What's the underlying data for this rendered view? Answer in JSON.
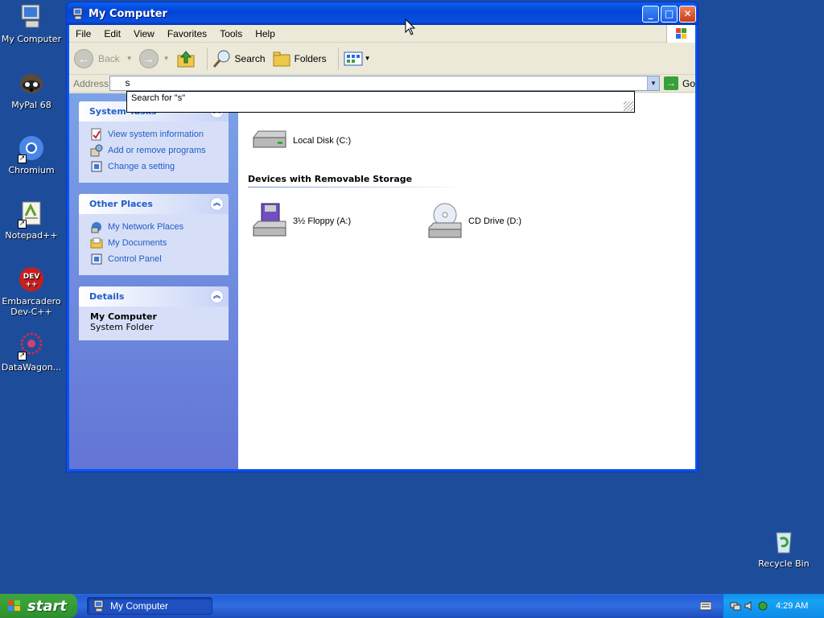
{
  "desktop": {
    "icons": [
      {
        "label": "My Computer",
        "icon": "my-computer-icon",
        "shortcut": false
      },
      {
        "label": "MyPal 68",
        "icon": "raccoon-icon",
        "shortcut": false
      },
      {
        "label": "Chromium",
        "icon": "chromium-icon",
        "shortcut": true
      },
      {
        "label": "Notepad++",
        "icon": "notepadpp-icon",
        "shortcut": true
      },
      {
        "label": "Embarcadero Dev-C++",
        "icon": "devcpp-icon",
        "shortcut": true
      },
      {
        "label": "DataWagon...",
        "icon": "datawagon-icon",
        "shortcut": true
      }
    ],
    "recycle_bin": "Recycle Bin"
  },
  "window": {
    "title": "My Computer",
    "menu": [
      "File",
      "Edit",
      "View",
      "Favorites",
      "Tools",
      "Help"
    ],
    "toolbar": {
      "back": "Back",
      "search": "Search",
      "folders": "Folders"
    },
    "address": {
      "label": "Address",
      "value": "s",
      "go": "Go",
      "suggestion": "Search for \"s\""
    },
    "panels": {
      "system_tasks": {
        "title": "System Tasks",
        "items": [
          "View system information",
          "Add or remove programs",
          "Change a setting"
        ]
      },
      "other_places": {
        "title": "Other Places",
        "items": [
          "My Network Places",
          "My Documents",
          "Control Panel"
        ]
      },
      "details": {
        "title": "Details",
        "name": "My Computer",
        "type": "System Folder"
      }
    },
    "drives": {
      "local_disk": "Local Disk (C:)",
      "group_removable": "Devices with Removable Storage",
      "floppy": "3½ Floppy (A:)",
      "cd": "CD Drive (D:)"
    }
  },
  "taskbar": {
    "start": "start",
    "task_button": "My Computer",
    "clock": "4:29 AM"
  },
  "colors": {
    "desktop": "#1d4d9a",
    "link": "#215dc6",
    "start": "#37a137"
  }
}
